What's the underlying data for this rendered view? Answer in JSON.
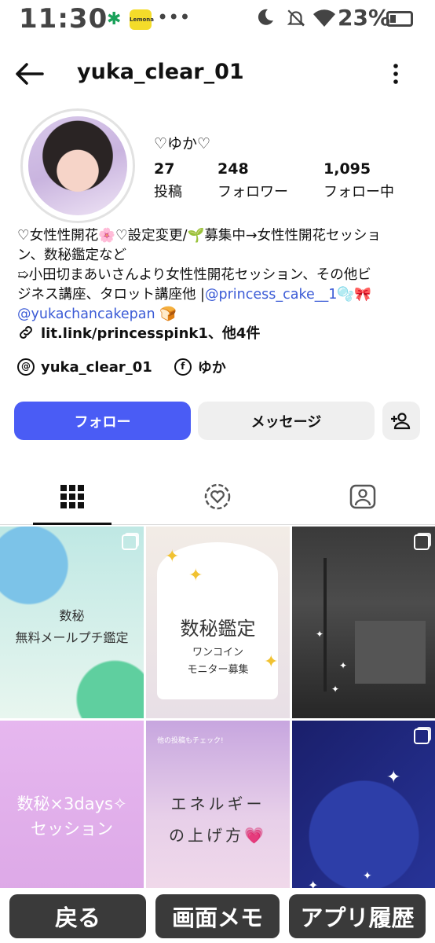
{
  "status_bar": {
    "time": "11:30",
    "lemon_label": "Lemona",
    "more": "•••",
    "battery": "23%"
  },
  "header": {
    "username": "yuka_clear_01"
  },
  "profile": {
    "display_name": "♡ゆか♡",
    "stats": [
      {
        "value": "27",
        "label": "投稿"
      },
      {
        "value": "248",
        "label": "フォロワー"
      },
      {
        "value": "1,095",
        "label": "フォロー中"
      }
    ],
    "bio_line1": "♡女性性開花🌸♡設定変更/🌱募集中→女性性開花セッショ",
    "bio_line2": "ン、数秘鑑定など",
    "bio_line3": "➯小田切まあいさんより女性性開花セッション、その他ビ",
    "bio_line4a": "ジネス講座、タロット講座他 |",
    "bio_mention1": "@princess_cake__1",
    "bio_line4b": "🫧🎀",
    "bio_mention2": "@yukachancakepan",
    "bio_line5b": "🍞",
    "link": "lit.link/princesspink1、他4件",
    "threads": "yuka_clear_01",
    "facebook": "ゆか"
  },
  "actions": {
    "follow": "フォロー",
    "message": "メッセージ"
  },
  "posts": {
    "p1_line1": "数秘",
    "p1_line2": "無料メールプチ鑑定",
    "p2_line1": "数秘鑑定",
    "p2_line2": "ワンコイン",
    "p2_line3": "モニター募集",
    "p4_line1": "数秘×3days✧",
    "p4_line2": "セッション",
    "p5_mini": "他の投稿もチェック!",
    "p5_line1": "エネルギー",
    "p5_line2": "の上げ方💗"
  },
  "bottom_bar": {
    "back": "戻る",
    "memo": "画面メモ",
    "history": "アプリ履歴"
  },
  "colors": {
    "follow_button": "#4a5cf5",
    "link": "#3b5bd6"
  }
}
